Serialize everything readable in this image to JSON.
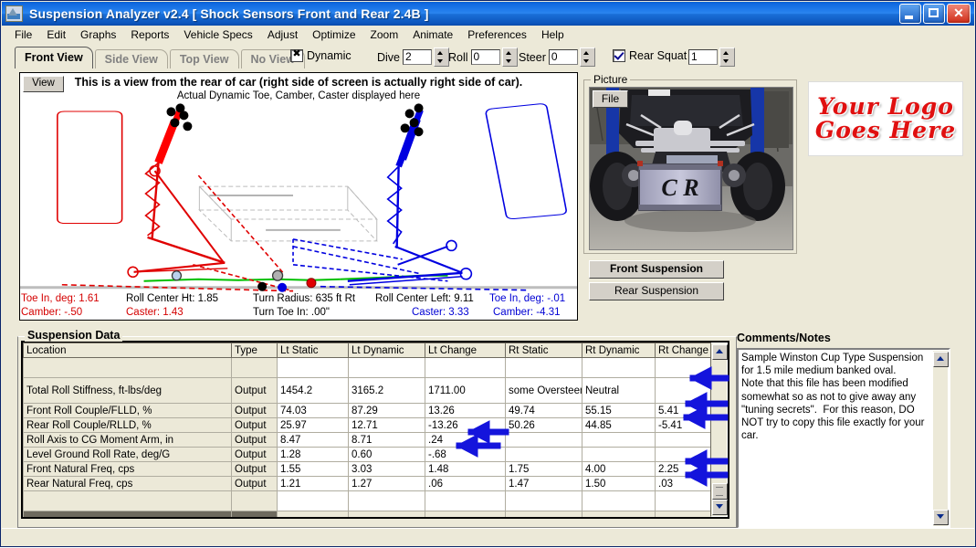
{
  "window": {
    "title": "Suspension Analyzer v2.4   [ Shock Sensors Front and Rear 2.4B ]",
    "app_icon": "suspension-icon",
    "minimize": "_",
    "maximize": "□",
    "close": "✕"
  },
  "menu": [
    "File",
    "Edit",
    "Graphs",
    "Reports",
    "Vehicle Specs",
    "Adjust",
    "Optimize",
    "Zoom",
    "Animate",
    "Preferences",
    "Help"
  ],
  "tabs": [
    {
      "label": "Front View",
      "active": true
    },
    {
      "label": "Side View",
      "active": false
    },
    {
      "label": "Top View",
      "active": false
    },
    {
      "label": "No View",
      "active": false
    }
  ],
  "toolbar": {
    "dynamic": {
      "label": "Dynamic",
      "checked": true
    },
    "dive": {
      "label": "Dive",
      "value": "2"
    },
    "roll": {
      "label": "Roll",
      "value": "0"
    },
    "steer": {
      "label": "Steer",
      "value": "0"
    },
    "rear_squat": {
      "label": "Rear Squat",
      "value": "1",
      "checked": true
    }
  },
  "view_panel": {
    "view_button": "View",
    "headline": "This is a view from the rear of car (right side of screen is actually right side of car).",
    "subline": "Actual Dynamic Toe, Camber, Caster displayed here"
  },
  "readout": {
    "left": [
      {
        "label": "Toe In, deg: 1.61"
      },
      {
        "label": "Camber: -.50"
      }
    ],
    "mid1": [
      {
        "label": "Roll Center Ht: 1.85"
      },
      {
        "label": "Caster: 1.43"
      }
    ],
    "mid2": [
      {
        "label": "Turn Radius: 635 ft Rt"
      },
      {
        "label": "Turn Toe In: .00\""
      }
    ],
    "mid3": [
      {
        "label": "Roll Center Left: 9.11"
      },
      {
        "label": "Caster: 3.33"
      }
    ],
    "right": [
      {
        "label": "Toe In, deg: -.01"
      },
      {
        "label": "Camber: -4.31"
      }
    ]
  },
  "picture": {
    "group_label": "Picture",
    "file_button": "File",
    "image_alt": "race-car-front-suspension-photo",
    "radiator_text": "C R"
  },
  "suspension_buttons": [
    {
      "label": "Front Suspension",
      "selected": true
    },
    {
      "label": "Rear Suspension",
      "selected": false
    }
  ],
  "logo": {
    "line1": "Your Logo",
    "line2": "Goes Here",
    "color": "#e01010"
  },
  "data_group": {
    "label": "Suspension Data",
    "columns": [
      "Location",
      "Type",
      "Lt Static",
      "Lt Dynamic",
      "Lt Change",
      "Rt Static",
      "Rt Dynamic",
      "Rt Change"
    ],
    "rows": [
      {
        "cells": [
          "",
          "",
          "",
          "",
          "",
          "",
          "",
          ""
        ],
        "blank": true
      },
      {
        "cells": [
          "Total Roll Stiffness, ft-lbs/deg",
          "Output",
          "1454.2",
          "3165.2",
          "1711.00",
          "some Oversteer",
          "Neutral",
          ""
        ],
        "tall": true
      },
      {
        "cells": [
          "Front Roll Couple/FLLD, %",
          "Output",
          "74.03",
          "87.29",
          "13.26",
          "49.74",
          "55.15",
          "5.41"
        ]
      },
      {
        "cells": [
          "Rear Roll Couple/RLLD, %",
          "Output",
          "25.97",
          "12.71",
          "-13.26",
          "50.26",
          "44.85",
          "-5.41"
        ]
      },
      {
        "cells": [
          "Roll Axis to CG Moment Arm, in",
          "Output",
          "8.47",
          "8.71",
          ".24",
          "",
          "",
          ""
        ]
      },
      {
        "cells": [
          "Level Ground Roll Rate, deg/G",
          "Output",
          "1.28",
          "0.60",
          "-.68",
          "",
          "",
          ""
        ]
      },
      {
        "cells": [
          "Front Natural Freq, cps",
          "Output",
          "1.55",
          "3.03",
          "1.48",
          "1.75",
          "4.00",
          "2.25"
        ]
      },
      {
        "cells": [
          "Rear Natural Freq, cps",
          "Output",
          "1.21",
          "1.27",
          ".06",
          "1.47",
          "1.50",
          ".03"
        ]
      },
      {
        "cells": [
          "",
          "",
          "",
          "",
          "",
          "",
          "",
          ""
        ],
        "blank": true
      }
    ]
  },
  "comments": {
    "label": "Comments/Notes",
    "text": "Sample Winston Cup Type Suspension for 1.5 mile medium banked oval.\nNote that this file has been modified somewhat so as not to give away any \"tuning secrets\".  For this reason, DO NOT try to copy this file exactly for your car."
  },
  "annotations": {
    "arrow_color": "#1414dc",
    "count": 6,
    "description": "blue arrows pointing at output rows"
  }
}
